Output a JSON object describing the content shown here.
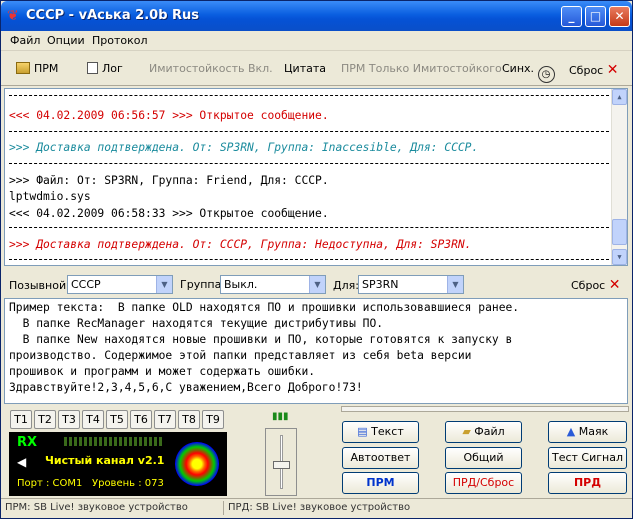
{
  "window": {
    "title": "СССР - vАська 2.0b Rus"
  },
  "menu": [
    "Файл",
    "Опции",
    "Протокол"
  ],
  "toolbar": {
    "prm": "ПРМ",
    "log": "Лог",
    "imito": "Имитостойкость Вкл.",
    "quote": "Цитата",
    "prm_only": "ПРМ Только Имитостойкого",
    "sync": "Синх.",
    "reset": "Сброс"
  },
  "log": {
    "lines": [
      "<<< 04.02.2009 06:56:57 >>> Открытое сообщение.",
      ">>> Доставка подтверждена. От: SP3RN, Группа: Inaccesible, Для: СССР.",
      ">>> Файл: От: SP3RN, Группа: Friend, Для: СССР.",
      "lptwdmio.sys",
      "<<< 04.02.2009 06:58:33 >>> Открытое сообщение.",
      ">>> Доставка подтверждена. От: СССР, Группа: Недоступна, Для: SP3RN."
    ]
  },
  "address": {
    "callsign_label": "Позывной:",
    "callsign_value": "СССР",
    "group_label": "Группа:",
    "group_value": "Выкл.",
    "to_label": "Для:",
    "to_value": "SP3RN",
    "reset": "Сброс"
  },
  "compose": {
    "lines": [
      "Пример текста:  В папке OLD находятся ПО и прошивки использовавшиеся ранее.",
      "  В папке RecManager находятся текущие дистрибутивы ПО.",
      "  В папке New находятся новые прошивки и ПО, которые готовятся к запуску в",
      "производство. Содержимое этой папки представляет из себя beta версии",
      "прошивок и программ и может содержать ошибки.",
      "Здравствуйте!2,3,4,5,6,С уважением,Всего Доброго!73!"
    ]
  },
  "tkeys": [
    "T1",
    "T2",
    "T3",
    "T4",
    "T5",
    "T6",
    "T7",
    "T8",
    "T9"
  ],
  "lcd": {
    "rx": "RX",
    "channel": "Чистый канал v2.1",
    "port": "Порт : COM1",
    "level": "Уровень : 073"
  },
  "buttons": {
    "text": "Текст",
    "file": "Файл",
    "beacon": "Маяк",
    "autoreply": "Автоответ",
    "general_call": "Общий Вызов",
    "test_signal": "Тест Сигнал",
    "prm": "ПРМ",
    "prd_reset": "ПРД/Сброс",
    "prd": "ПРД"
  },
  "status": {
    "rx": "ПРМ: SB Live! звуковое устройство",
    "tx": "ПРД: SB Live! звуковое устройство"
  }
}
